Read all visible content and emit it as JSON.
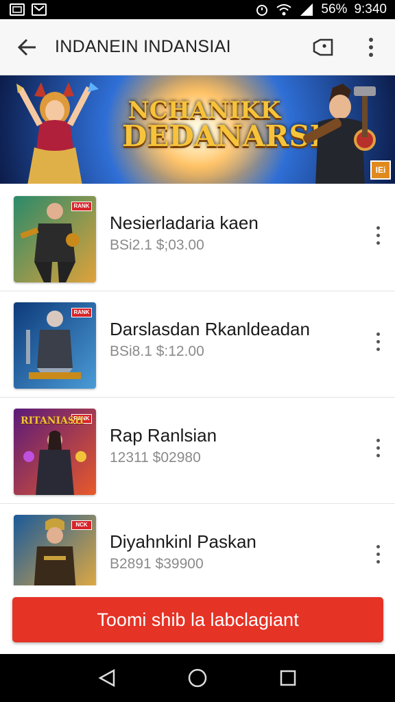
{
  "status_bar": {
    "battery": "56%",
    "time": "9:340"
  },
  "header": {
    "title": "INDANEIN INDANSIAI"
  },
  "banner": {
    "line1": "NCHANIKK",
    "line2": "DEDANARSH",
    "badge": "IEi"
  },
  "products": [
    {
      "title": "Nesierladaria kaen",
      "price": "BSi2.1 $;03.00",
      "badge": "RANK",
      "colors": {
        "bg1": "#2a8a6a",
        "bg2": "#e0a23a",
        "hero": "#2b2b2b",
        "accent": "#c98a1a"
      }
    },
    {
      "title": "Darslasdan Rkanldeadan",
      "price": "BSi8.1 $:12.00",
      "badge": "RANK",
      "colors": {
        "bg1": "#0e3a7a",
        "bg2": "#4a9bd6",
        "hero": "#3a3f4a",
        "accent": "#9aa7b8"
      }
    },
    {
      "title": "Rap Ranlsian",
      "price": "12311  $02980",
      "badge": "RANK",
      "thumb_text": "RITANIASH",
      "colors": {
        "bg1": "#5a1a7a",
        "bg2": "#e85a2a",
        "hero": "#2a2a36",
        "accent": "#f2c33a"
      }
    },
    {
      "title": "Diyahnkinl Paskan",
      "price": "B2891  $39900",
      "badge": "NCK",
      "colors": {
        "bg1": "#1a5a9a",
        "bg2": "#f0b03a",
        "hero": "#3a2a1a",
        "accent": "#c9a13a"
      }
    }
  ],
  "cta": {
    "label": "Toomi shib la labclagiant"
  },
  "icons": {
    "back": "arrow-left-icon",
    "share": "tag-icon",
    "more": "more-vert-icon",
    "nav_back": "triangle-back-icon",
    "nav_home": "circle-home-icon",
    "nav_recent": "square-recent-icon"
  },
  "colors": {
    "accent": "#e53326",
    "header_bg": "#f7f7f7"
  }
}
